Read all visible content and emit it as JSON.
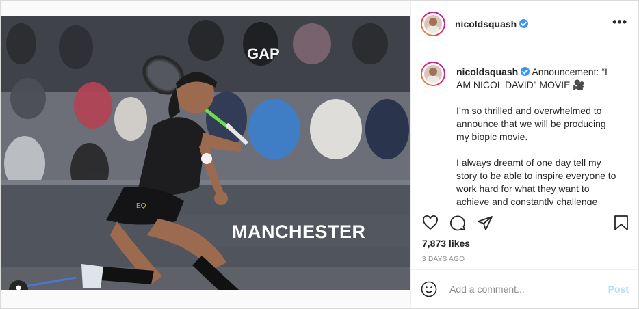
{
  "post": {
    "username": "nicoldsquash",
    "verified": true,
    "more_label": "•••"
  },
  "photo": {
    "banner_text": "MANCHESTER",
    "crowd_shirt_text": "GAP",
    "shorts_text": "EQ"
  },
  "caption": {
    "username": "nicoldsquash",
    "title": "Announcement: “I AM NICOL DAVID” MOVIE 🎥",
    "paragraph_1": "I’m so thrilled and overwhelmed to announce that we will be producing my biopic movie.",
    "paragraph_2": "I always dreamt of one day tell my story to be able to inspire everyone to work hard for what they want to achieve and constantly challenge"
  },
  "stats": {
    "likes": "7,873 likes",
    "time_ago": "3 DAYS AGO"
  },
  "comment": {
    "placeholder": "Add a comment...",
    "post_label": "Post"
  },
  "icons": {
    "like": "heart-icon",
    "comment": "comment-icon",
    "share": "share-icon",
    "save": "bookmark-icon",
    "emoji": "emoji-icon",
    "user_tag": "user-tag-icon"
  },
  "colors": {
    "verified": "#3897f0",
    "post_button": "#b2dffc",
    "muted_text": "#8e8e8e"
  }
}
